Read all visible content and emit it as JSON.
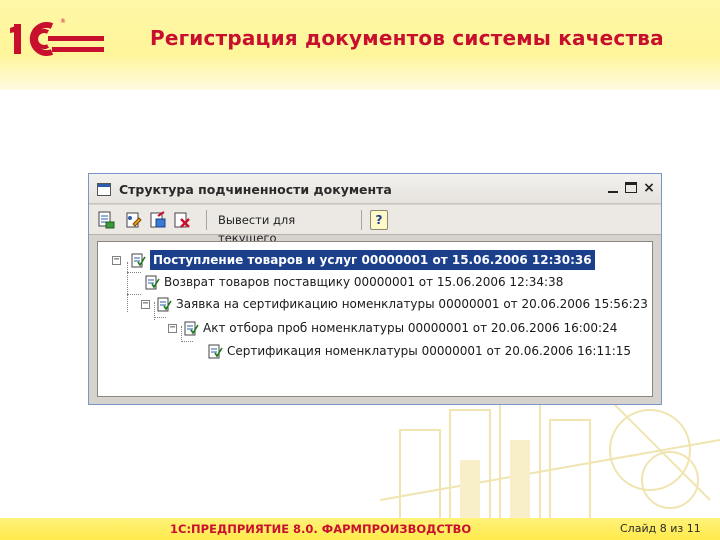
{
  "slide": {
    "logo_text": "1С",
    "title": "Регистрация документов системы качества"
  },
  "window": {
    "title": "Структура подчиненности документа",
    "controls": {
      "minimize": "_",
      "maximize": "□",
      "close": "×"
    }
  },
  "toolbar": {
    "output_label": "Вывести для текущего",
    "help_label": "?"
  },
  "tree": {
    "rows": [
      {
        "label": "Поступление товаров и услуг 00000001 от 15.06.2006 12:30:36",
        "selected": true
      },
      {
        "label": "Возврат товаров поставщику 00000001 от 15.06.2006 12:34:38"
      },
      {
        "label": "Заявка на сертификацию номенклатуры 00000001 от 20.06.2006 15:56:23"
      },
      {
        "label": "Акт отбора проб номенклатуры 00000001 от 20.06.2006 16:00:24"
      },
      {
        "label": "Сертификация номенклатуры 00000001 от 20.06.2006 16:11:15"
      }
    ]
  },
  "footer": {
    "product": "1С:ПРЕДПРИЯТИЕ 8.0. ФАРМПРОИЗВОДСТВО",
    "slide_counter": "Слайд 8 из 11"
  },
  "colors": {
    "title_red": "#c8102e",
    "header_yellow": "#fff59a",
    "selection_blue": "#1b3f8a"
  }
}
